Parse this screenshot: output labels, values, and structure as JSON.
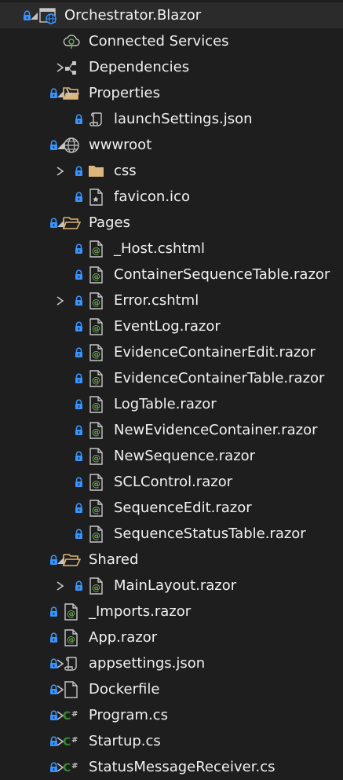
{
  "colors": {
    "background": "#1e1e1e",
    "text": "#f1f1f1",
    "lock": "#3794ff",
    "folder": "#dcb67a",
    "csharp": "#368832",
    "razor_at": "#6aa84f",
    "glyph": "#c5c5c5"
  },
  "tree": [
    {
      "label": "Orchestrator.Blazor",
      "level": 0,
      "chevron": "expanded",
      "lock": true,
      "icon": "web-project-icon"
    },
    {
      "label": "Connected Services",
      "level": 1,
      "chevron": "none",
      "lock": false,
      "icon": "connected-services-icon"
    },
    {
      "label": "Dependencies",
      "level": 1,
      "chevron": "collapsed",
      "lock": false,
      "icon": "dependencies-icon"
    },
    {
      "label": "Properties",
      "level": 1,
      "chevron": "expanded",
      "lock": true,
      "icon": "properties-folder-icon"
    },
    {
      "label": "launchSettings.json",
      "level": 2,
      "chevron": "none",
      "lock": true,
      "icon": "json-file-icon"
    },
    {
      "label": "wwwroot",
      "level": 1,
      "chevron": "expanded",
      "lock": true,
      "icon": "globe-icon"
    },
    {
      "label": "css",
      "level": 2,
      "chevron": "collapsed",
      "lock": true,
      "icon": "folder-icon"
    },
    {
      "label": "favicon.ico",
      "level": 2,
      "chevron": "none",
      "lock": true,
      "icon": "image-file-icon"
    },
    {
      "label": "Pages",
      "level": 1,
      "chevron": "expanded",
      "lock": true,
      "icon": "open-folder-icon"
    },
    {
      "label": "_Host.cshtml",
      "level": 2,
      "chevron": "none",
      "lock": true,
      "icon": "razor-file-icon"
    },
    {
      "label": "ContainerSequenceTable.razor",
      "level": 2,
      "chevron": "none",
      "lock": true,
      "icon": "razor-file-icon"
    },
    {
      "label": "Error.cshtml",
      "level": 2,
      "chevron": "collapsed",
      "lock": true,
      "icon": "razor-file-icon"
    },
    {
      "label": "EventLog.razor",
      "level": 2,
      "chevron": "none",
      "lock": true,
      "icon": "razor-file-icon"
    },
    {
      "label": "EvidenceContainerEdit.razor",
      "level": 2,
      "chevron": "none",
      "lock": true,
      "icon": "razor-file-icon"
    },
    {
      "label": "EvidenceContainerTable.razor",
      "level": 2,
      "chevron": "none",
      "lock": true,
      "icon": "razor-file-icon"
    },
    {
      "label": "LogTable.razor",
      "level": 2,
      "chevron": "none",
      "lock": true,
      "icon": "razor-file-icon"
    },
    {
      "label": "NewEvidenceContainer.razor",
      "level": 2,
      "chevron": "none",
      "lock": true,
      "icon": "razor-file-icon"
    },
    {
      "label": "NewSequence.razor",
      "level": 2,
      "chevron": "none",
      "lock": true,
      "icon": "razor-file-icon"
    },
    {
      "label": "SCLControl.razor",
      "level": 2,
      "chevron": "none",
      "lock": true,
      "icon": "razor-file-icon"
    },
    {
      "label": "SequenceEdit.razor",
      "level": 2,
      "chevron": "none",
      "lock": true,
      "icon": "razor-file-icon"
    },
    {
      "label": "SequenceStatusTable.razor",
      "level": 2,
      "chevron": "none",
      "lock": true,
      "icon": "razor-file-icon"
    },
    {
      "label": "Shared",
      "level": 1,
      "chevron": "expanded",
      "lock": true,
      "icon": "open-folder-icon"
    },
    {
      "label": "MainLayout.razor",
      "level": 2,
      "chevron": "collapsed",
      "lock": true,
      "icon": "razor-file-icon"
    },
    {
      "label": "_Imports.razor",
      "level": 1,
      "chevron": "none",
      "lock": true,
      "icon": "razor-file-icon"
    },
    {
      "label": "App.razor",
      "level": 1,
      "chevron": "none",
      "lock": true,
      "icon": "razor-file-icon"
    },
    {
      "label": "appsettings.json",
      "level": 1,
      "chevron": "collapsed",
      "lock": true,
      "icon": "json-file-icon"
    },
    {
      "label": "Dockerfile",
      "level": 1,
      "chevron": "collapsed",
      "lock": true,
      "icon": "file-icon"
    },
    {
      "label": "Program.cs",
      "level": 1,
      "chevron": "collapsed",
      "lock": true,
      "icon": "csharp-file-icon"
    },
    {
      "label": "Startup.cs",
      "level": 1,
      "chevron": "collapsed",
      "lock": true,
      "icon": "csharp-file-icon"
    },
    {
      "label": "StatusMessageReceiver.cs",
      "level": 1,
      "chevron": "collapsed",
      "lock": true,
      "icon": "csharp-file-icon"
    }
  ]
}
